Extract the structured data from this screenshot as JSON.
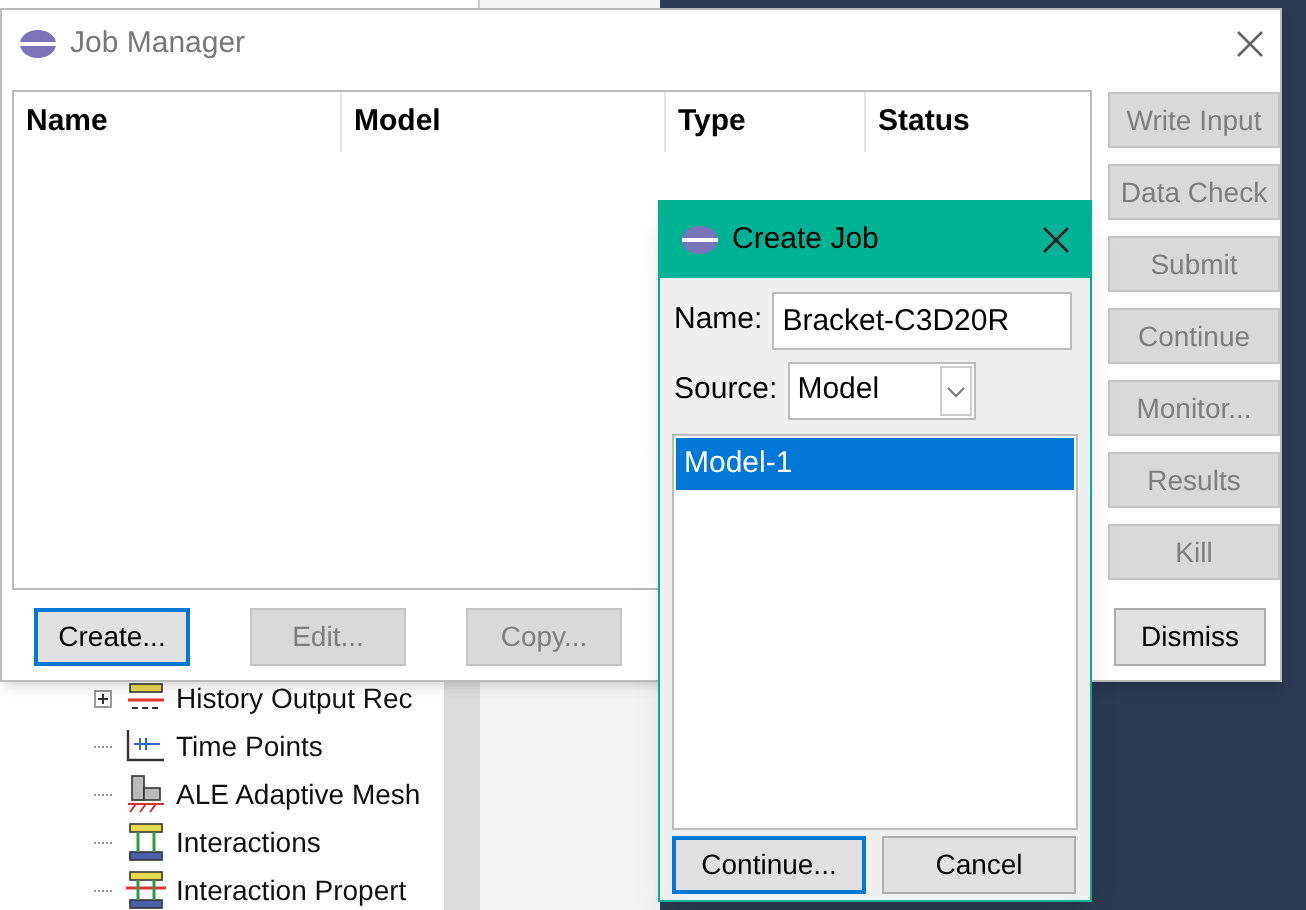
{
  "model_tree": {
    "items": [
      {
        "label": "History Output Rec",
        "has_children": true,
        "expanded": false,
        "kind": "history"
      },
      {
        "label": "Time Points",
        "has_children": false,
        "kind": "time"
      },
      {
        "label": "ALE Adaptive Mesh",
        "has_children": false,
        "kind": "ale"
      },
      {
        "label": "Interactions",
        "has_children": false,
        "kind": "interaction"
      },
      {
        "label": "Interaction Propert",
        "has_children": false,
        "kind": "property"
      }
    ]
  },
  "job_manager": {
    "title": "Job Manager",
    "columns": [
      "Name",
      "Model",
      "Type",
      "Status"
    ],
    "side_buttons": [
      {
        "label": "Write Input",
        "disabled": true
      },
      {
        "label": "Data Check",
        "disabled": true
      },
      {
        "label": "Submit",
        "disabled": true
      },
      {
        "label": "Continue",
        "disabled": true
      },
      {
        "label": "Monitor...",
        "disabled": true
      },
      {
        "label": "Results",
        "disabled": true
      },
      {
        "label": "Kill",
        "disabled": true
      }
    ],
    "bottom_buttons": [
      {
        "label": "Create...",
        "disabled": false,
        "focused": true
      },
      {
        "label": "Edit...",
        "disabled": true,
        "focused": false
      },
      {
        "label": "Copy...",
        "disabled": true,
        "focused": false
      }
    ],
    "dismiss": "Dismiss"
  },
  "create_job": {
    "title": "Create Job",
    "name_label": "Name:",
    "name_value": "Bracket-C3D20R",
    "source_label": "Source:",
    "source_value": "Model",
    "models": [
      {
        "label": "Model-1",
        "selected": true
      }
    ],
    "buttons": [
      {
        "label": "Continue...",
        "focused": true
      },
      {
        "label": "Cancel",
        "focused": false
      }
    ]
  }
}
